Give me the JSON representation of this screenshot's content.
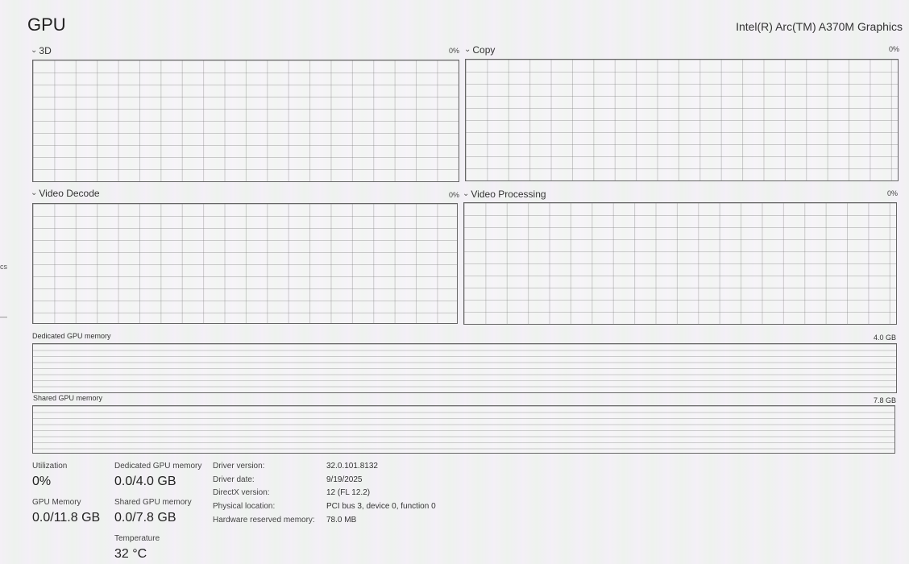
{
  "header": {
    "title": "GPU",
    "device": "Intel(R) Arc(TM) A370M Graphics"
  },
  "engines": [
    {
      "label": "3D",
      "percent": "0%"
    },
    {
      "label": "Copy",
      "percent": "0%"
    },
    {
      "label": "Video Decode",
      "percent": "0%"
    },
    {
      "label": "Video Processing",
      "percent": "0%"
    }
  ],
  "memory_graphs": {
    "dedicated": {
      "label": "Dedicated GPU memory",
      "max": "4.0 GB"
    },
    "shared": {
      "label": "Shared GPU memory",
      "max": "7.8 GB"
    }
  },
  "stats": {
    "utilization": {
      "label": "Utilization",
      "value": "0%"
    },
    "dedicated": {
      "label": "Dedicated GPU memory",
      "value": "0.0/4.0 GB"
    },
    "gpu_memory": {
      "label": "GPU Memory",
      "value": "0.0/11.8 GB"
    },
    "shared": {
      "label": "Shared GPU memory",
      "value": "0.0/7.8 GB"
    },
    "temperature": {
      "label": "Temperature",
      "value": "32 °C"
    }
  },
  "details": [
    {
      "label": "Driver version:",
      "value": "32.0.101.8132"
    },
    {
      "label": "Driver date:",
      "value": "9/19/2025"
    },
    {
      "label": "DirectX version:",
      "value": "12 (FL 12.2)"
    },
    {
      "label": "Physical location:",
      "value": "PCI bus 3, device 0, function 0"
    },
    {
      "label": "Hardware reserved memory:",
      "value": "78.0 MB"
    }
  ],
  "side_marks": {
    "a": "cs",
    "b": "—"
  }
}
